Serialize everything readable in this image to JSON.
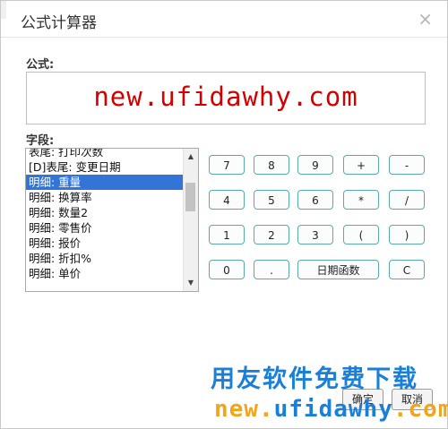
{
  "dialog": {
    "title": "公式计算器",
    "close_glyph": "×"
  },
  "formula": {
    "label": "公式:",
    "value": "new.ufidawhy.com"
  },
  "fields": {
    "label": "字段:",
    "items": [
      "表尾: 打印次数",
      "[D]表尾: 变更日期",
      "明细: 重量",
      "明细: 换算率",
      "明细: 数量2",
      "明细: 零售价",
      "明细: 报价",
      "明细: 折扣%",
      "明细: 单价"
    ],
    "selected": "明细: 重量"
  },
  "keypad": {
    "row1": [
      "7",
      "8",
      "9",
      "+",
      "-"
    ],
    "row2": [
      "4",
      "5",
      "6",
      "*",
      "/"
    ],
    "row3": [
      "1",
      "2",
      "3",
      "(",
      ")"
    ],
    "row4": [
      "0",
      ".",
      "日期函数",
      "C"
    ]
  },
  "footer": {
    "ok_label": "确定",
    "cancel_label": "取消"
  },
  "watermark": {
    "line1": "用友软件免费下载",
    "line2_a": "new.",
    "line2_b": "ufidawhy",
    "line2_c": ".com"
  }
}
